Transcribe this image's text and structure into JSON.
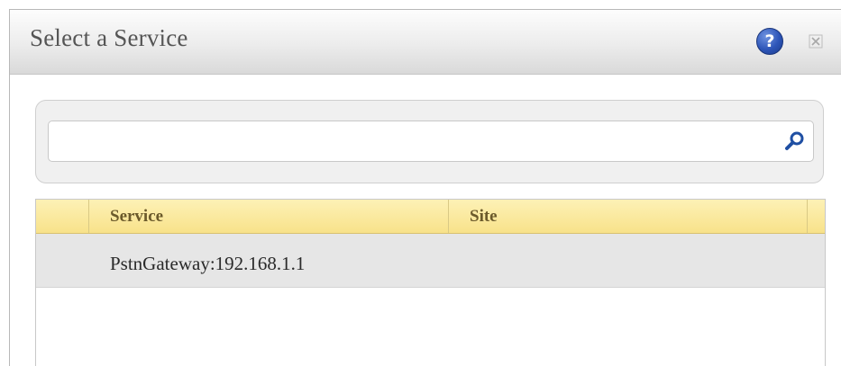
{
  "dialog": {
    "title": "Select a Service",
    "help_glyph": "?",
    "help_icon": "help-icon",
    "close_icon": "close-icon"
  },
  "search": {
    "value": "",
    "placeholder": "",
    "icon": "search-icon"
  },
  "table": {
    "columns": [
      "",
      "Service",
      "Site"
    ],
    "rows": [
      {
        "service": "PstnGateway:192.168.1.1",
        "site": ""
      }
    ]
  },
  "colors": {
    "header_bg": "#f8e28a",
    "header_text": "#6b5a2b",
    "row_bg": "#e6e6e6",
    "help_icon": "#2d55b8",
    "search_icon": "#1f4fa3"
  }
}
